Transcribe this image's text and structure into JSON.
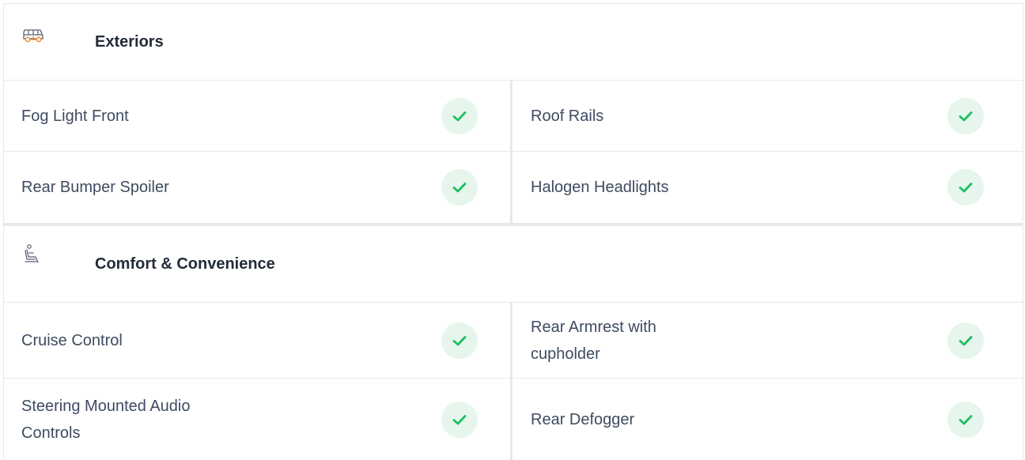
{
  "sections": [
    {
      "title": "Exteriors",
      "icon": "car-exterior-icon",
      "rows": [
        {
          "left": "Fog Light Front",
          "right": "Roof Rails"
        },
        {
          "left": "Rear Bumper Spoiler",
          "right": "Halogen Headlights"
        }
      ]
    },
    {
      "title": "Comfort & Convenience",
      "icon": "car-seat-icon",
      "rows": [
        {
          "left": "Cruise Control",
          "right": "Rear Armrest with cupholder"
        },
        {
          "left": "Steering Mounted Audio Controls",
          "right": "Rear Defogger"
        }
      ]
    }
  ],
  "colors": {
    "check_bg": "#e6f6ec",
    "check_mark": "#1fbf5f",
    "icon_orange": "#f08a24",
    "border": "#e6e8ec"
  }
}
